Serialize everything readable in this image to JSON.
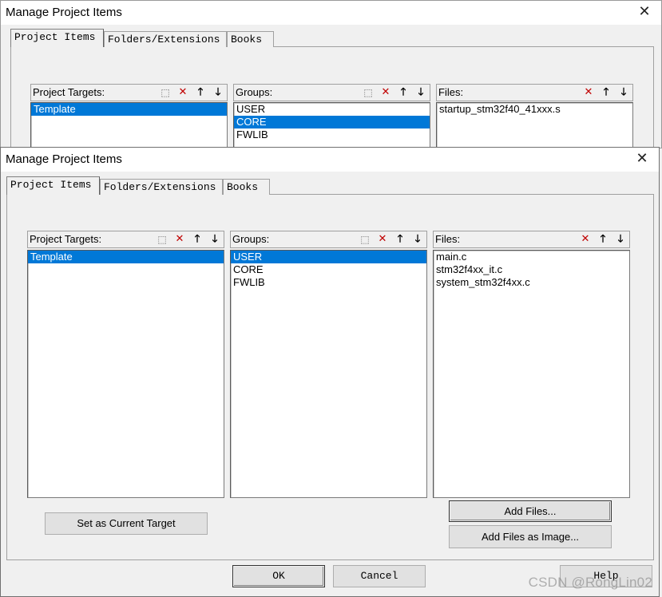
{
  "back_window": {
    "title": "Manage Project Items",
    "tabs": [
      {
        "label": "Project Items"
      },
      {
        "label": "Folders/Extensions"
      },
      {
        "label": "Books"
      }
    ],
    "targets_label": "Project Targets:",
    "targets_items": [
      "Template"
    ],
    "groups_label": "Groups:",
    "groups_items": [
      "USER",
      "CORE",
      "FWLIB"
    ],
    "files_label": "Files:",
    "files_items": [
      "startup_stm32f40_41xxx.s"
    ]
  },
  "front_window": {
    "title": "Manage Project Items",
    "tabs": [
      {
        "label": "Project Items"
      },
      {
        "label": "Folders/Extensions"
      },
      {
        "label": "Books"
      }
    ],
    "targets_label": "Project Targets:",
    "targets_items": [
      "Template"
    ],
    "groups_label": "Groups:",
    "groups_items": [
      "USER",
      "CORE",
      "FWLIB"
    ],
    "files_label": "Files:",
    "files_items": [
      "main.c",
      "stm32f4xx_it.c",
      "system_stm32f4xx.c"
    ],
    "set_current_target_label": "Set as Current Target",
    "add_files_label": "Add Files...",
    "add_files_image_label": "Add Files as Image...",
    "ok_label": "OK",
    "cancel_label": "Cancel",
    "help_label": "Help"
  },
  "icons": {
    "close": "close-icon",
    "new": "new-item-icon",
    "delete": "delete-icon",
    "move_up": "arrow-up-icon",
    "move_down": "arrow-down-icon"
  },
  "colors": {
    "selection": "#0078d7",
    "delete_icon": "#c00000"
  },
  "watermark": "CSDN @RongLin02"
}
